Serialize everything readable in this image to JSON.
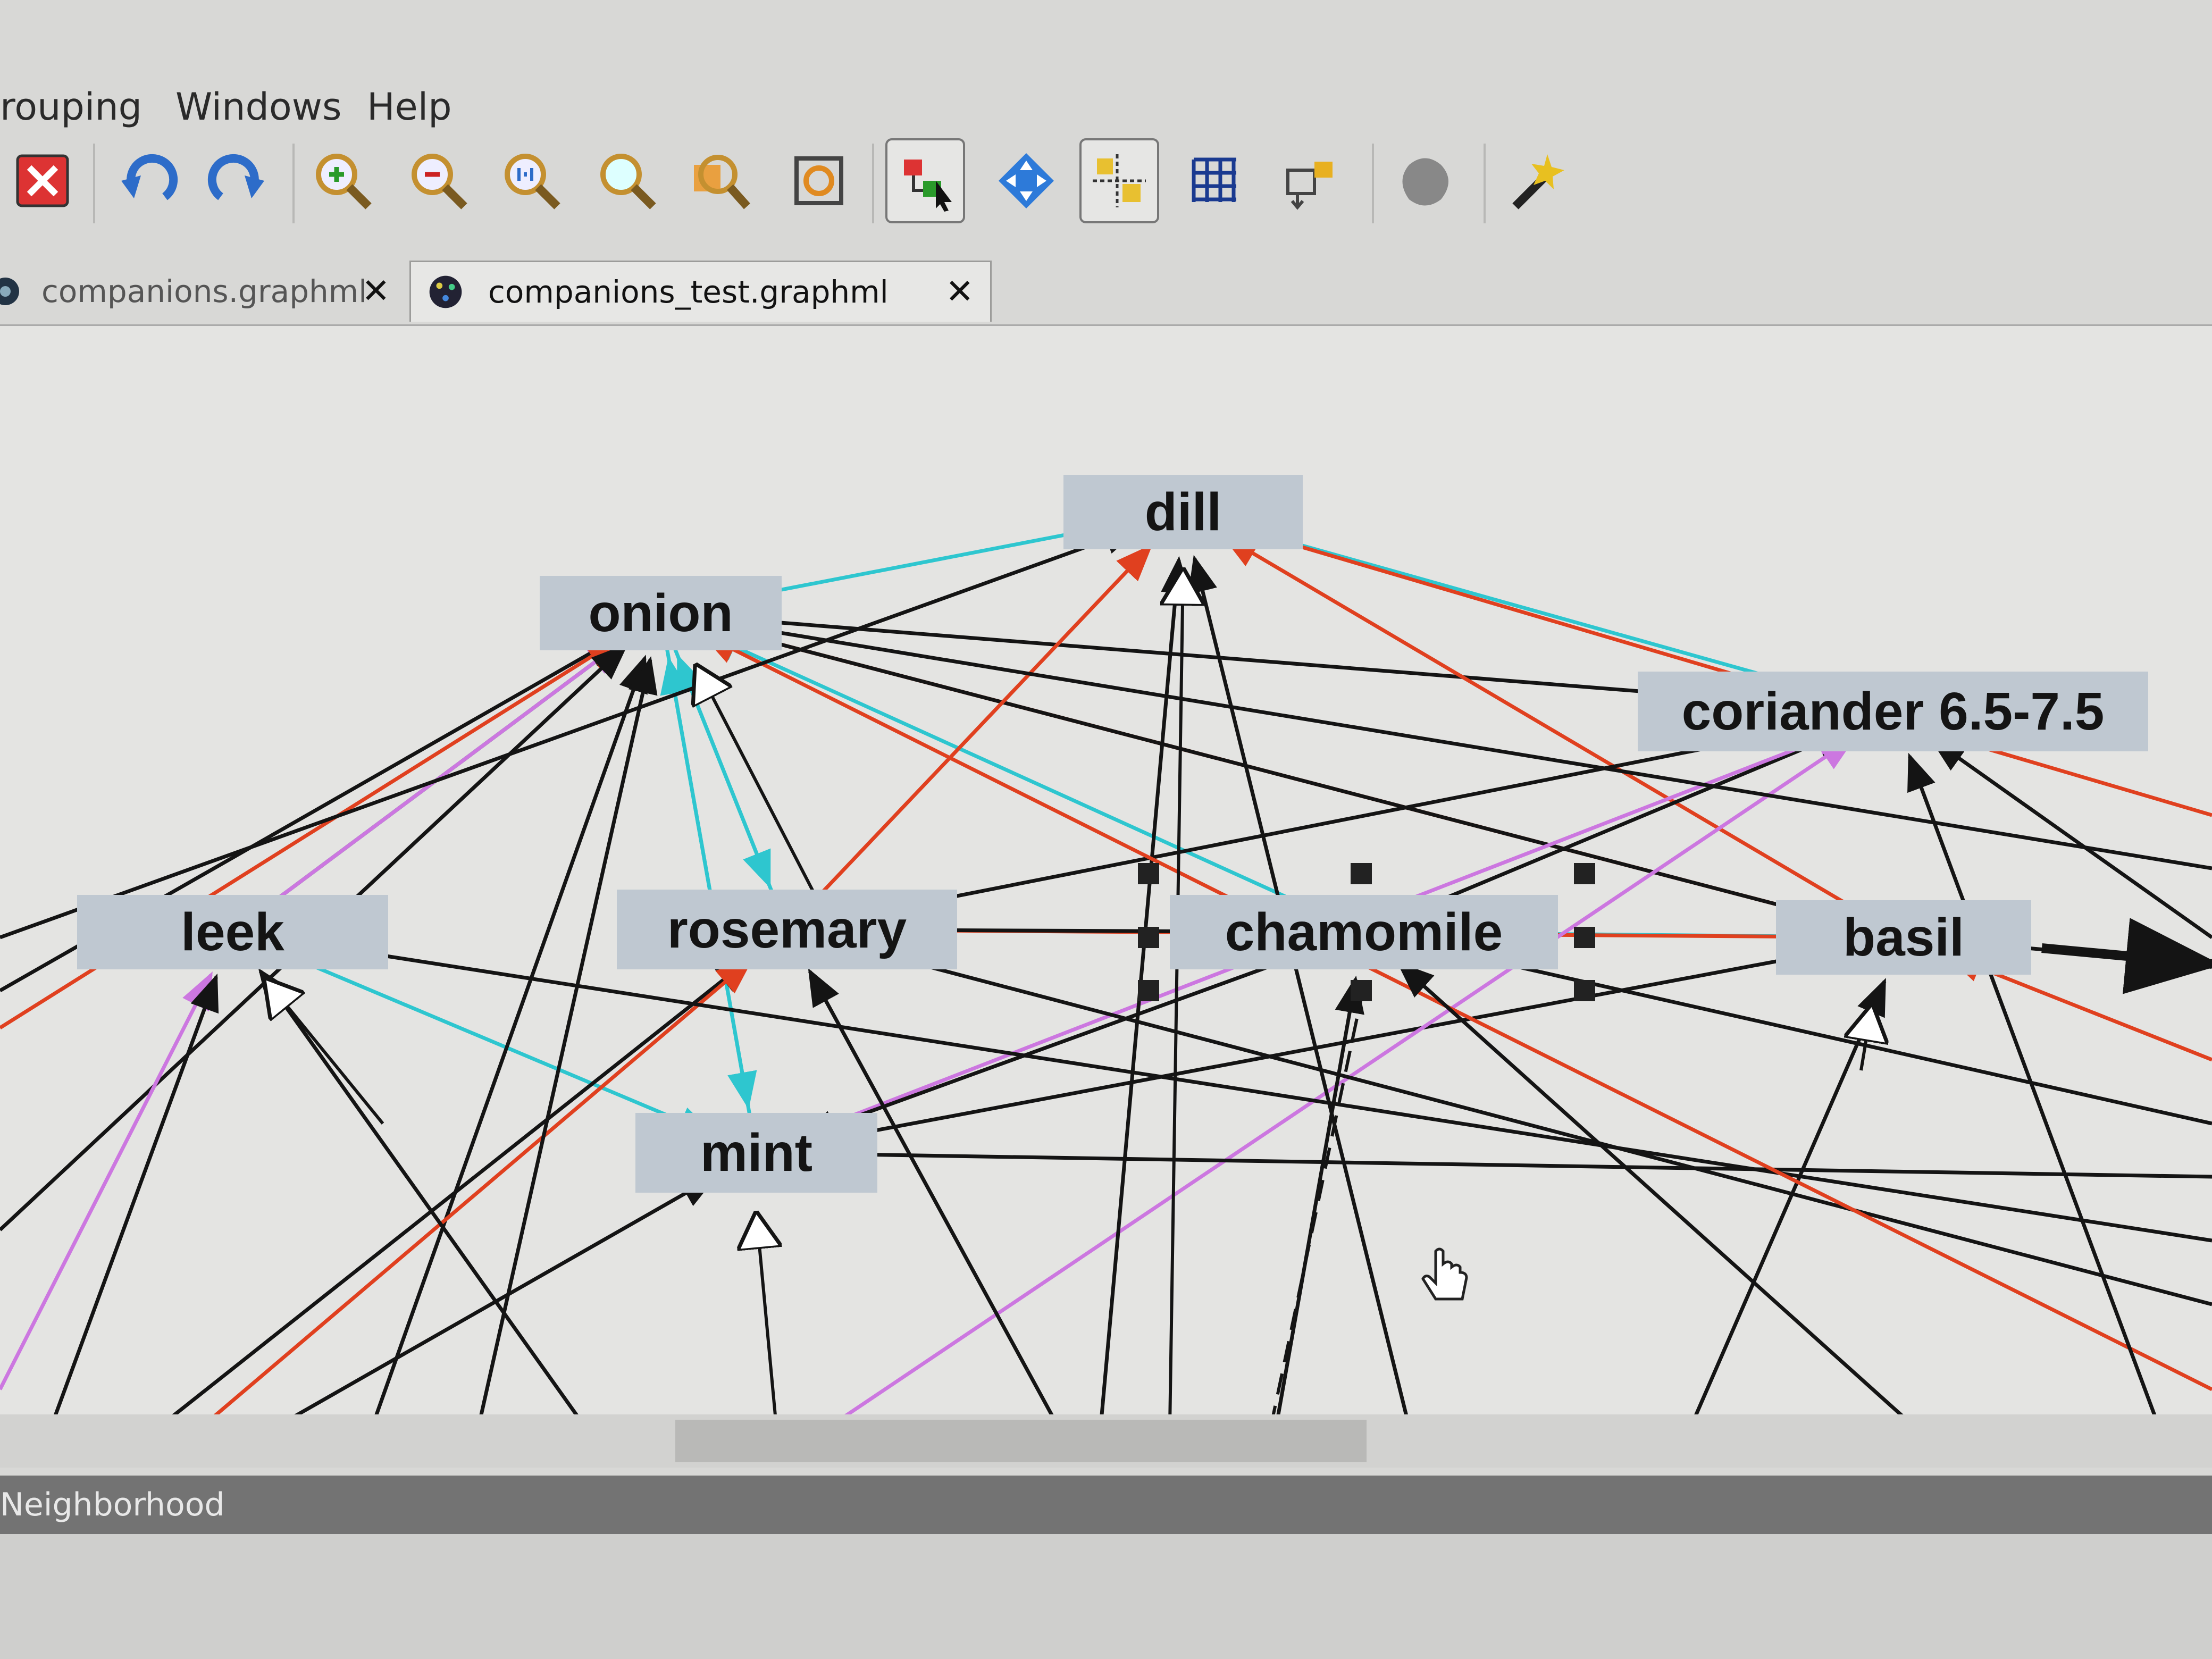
{
  "menu": {
    "items": [
      "rouping",
      "Windows",
      "Help"
    ]
  },
  "toolbar": {
    "buttons": [
      {
        "icon": "delete-icon"
      },
      {
        "icon": "undo-icon"
      },
      {
        "icon": "redo-icon"
      },
      {
        "icon": "zoom-in-icon"
      },
      {
        "icon": "zoom-out-icon"
      },
      {
        "icon": "zoom-1-1-icon"
      },
      {
        "icon": "zoom-icon"
      },
      {
        "icon": "zoom-selection-icon"
      },
      {
        "icon": "fit-content-icon"
      },
      {
        "icon": "edit-mode-icon",
        "pressed": true
      },
      {
        "icon": "navigate-icon"
      },
      {
        "icon": "snap-lines-icon",
        "pressed": true
      },
      {
        "icon": "grid-icon"
      },
      {
        "icon": "port-icon"
      },
      {
        "icon": "group-icon"
      },
      {
        "icon": "magic-wand-icon"
      }
    ]
  },
  "tabs": [
    {
      "label": "companions.graphml",
      "active": false
    },
    {
      "label": "companions_test.graphml",
      "active": true
    }
  ],
  "graph": {
    "nodes": [
      {
        "id": "dill",
        "label": "dill"
      },
      {
        "id": "onion",
        "label": "onion"
      },
      {
        "id": "coriander",
        "label": "coriander 6.5-7.5"
      },
      {
        "id": "leek",
        "label": "leek"
      },
      {
        "id": "rosemary",
        "label": "rosemary"
      },
      {
        "id": "chamomile",
        "label": "chamomile"
      },
      {
        "id": "basil",
        "label": "basil"
      },
      {
        "id": "mint",
        "label": "mint"
      }
    ],
    "edge_colors": {
      "black": "#141414",
      "red": "#e0401f",
      "cyan": "#2ec6cf",
      "violet": "#cc77e0"
    }
  },
  "status": {
    "label": "Neighborhood"
  },
  "colors": {
    "canvas": "#e4e4e2",
    "node_fill": "#bfc8d1",
    "selection_handle": "#222222"
  }
}
